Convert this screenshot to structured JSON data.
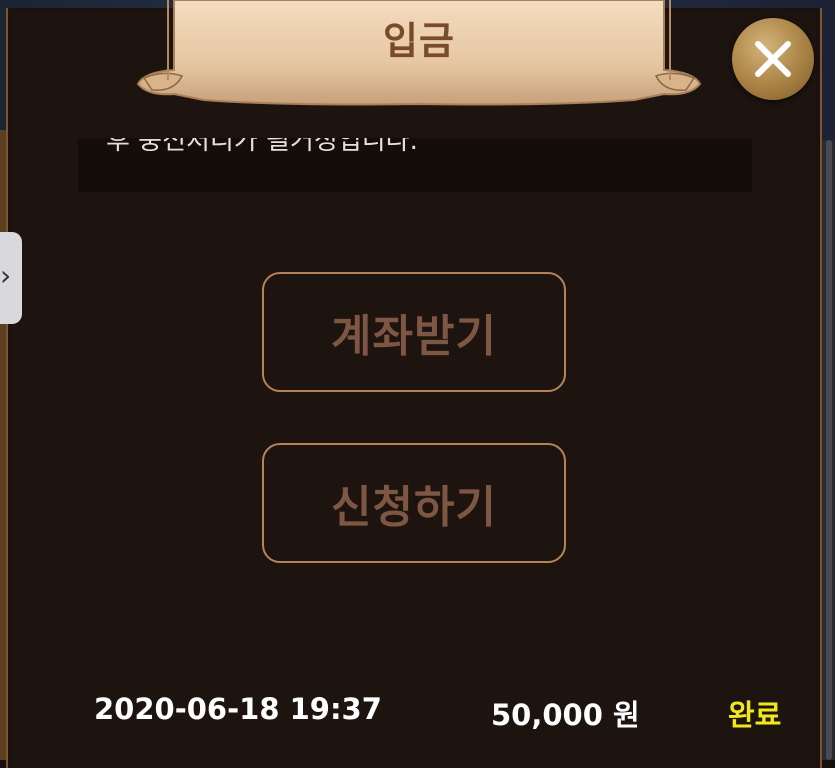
{
  "dialog": {
    "title": "입금",
    "notice_text": "후 충전처리가 될거정입니다."
  },
  "actions": {
    "account_button_label": "계좌받기",
    "apply_button_label": "신청하기"
  },
  "history": [
    {
      "date": "2020-06-18 19:37",
      "amount": "50,000 원",
      "status": "완료"
    }
  ],
  "icons": {
    "close": "close-icon",
    "side_handle": "chevron-right-icon"
  },
  "colors": {
    "panel_bg": "#1d1410",
    "button_border": "#b5835a",
    "button_text": "#7d5644",
    "status_complete": "#f1e81a",
    "banner_text": "#7a4a2c"
  }
}
